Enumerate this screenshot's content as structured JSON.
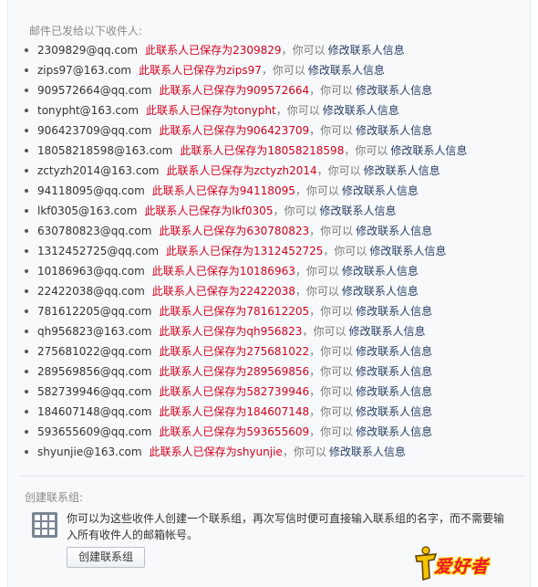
{
  "sent_heading": "邮件已发给以下收件人:",
  "recipients": [
    {
      "email": "2309829@qq.com",
      "saved": "此联系人已保存为2309829",
      "tail": "，你可以",
      "edit": "修改联系人信息"
    },
    {
      "email": "zips97@163.com",
      "saved": "此联系人已保存为zips97",
      "tail": "，你可以",
      "edit": "修改联系人信息"
    },
    {
      "email": "909572664@qq.com",
      "saved": "此联系人已保存为909572664",
      "tail": "，你可以",
      "edit": "修改联系人信息"
    },
    {
      "email": "tonypht@163.com",
      "saved": "此联系人已保存为tonypht",
      "tail": "，你可以",
      "edit": "修改联系人信息"
    },
    {
      "email": "906423709@qq.com",
      "saved": "此联系人已保存为906423709",
      "tail": "，你可以",
      "edit": "修改联系人信息"
    },
    {
      "email": "18058218598@163.com",
      "saved": "此联系人已保存为18058218598",
      "tail": "，你可以",
      "edit": "修改联系人信息"
    },
    {
      "email": "zctyzh2014@163.com",
      "saved": "此联系人已保存为zctyzh2014",
      "tail": "，你可以",
      "edit": "修改联系人信息"
    },
    {
      "email": "94118095@qq.com",
      "saved": "此联系人已保存为94118095",
      "tail": "，你可以",
      "edit": "修改联系人信息"
    },
    {
      "email": "lkf0305@163.com",
      "saved": "此联系人已保存为lkf0305",
      "tail": "，你可以",
      "edit": "修改联系人信息"
    },
    {
      "email": "630780823@qq.com",
      "saved": "此联系人已保存为630780823",
      "tail": "，你可以",
      "edit": "修改联系人信息"
    },
    {
      "email": "1312452725@qq.com",
      "saved": "此联系人已保存为1312452725",
      "tail": "，你可以",
      "edit": "修改联系人信息"
    },
    {
      "email": "10186963@qq.com",
      "saved": "此联系人已保存为10186963",
      "tail": "，你可以",
      "edit": "修改联系人信息"
    },
    {
      "email": "22422038@qq.com",
      "saved": "此联系人已保存为22422038",
      "tail": "，你可以",
      "edit": "修改联系人信息"
    },
    {
      "email": "781612205@qq.com",
      "saved": "此联系人已保存为781612205",
      "tail": "，你可以",
      "edit": "修改联系人信息"
    },
    {
      "email": "qh956823@163.com",
      "saved": "此联系人已保存为qh956823",
      "tail": "，你可以",
      "edit": "修改联系人信息"
    },
    {
      "email": "275681022@qq.com",
      "saved": "此联系人已保存为275681022",
      "tail": "，你可以",
      "edit": "修改联系人信息"
    },
    {
      "email": "289569856@qq.com",
      "saved": "此联系人已保存为289569856",
      "tail": "，你可以",
      "edit": "修改联系人信息"
    },
    {
      "email": "582739946@qq.com",
      "saved": "此联系人已保存为582739946",
      "tail": "，你可以",
      "edit": "修改联系人信息"
    },
    {
      "email": "184607148@qq.com",
      "saved": "此联系人已保存为184607148",
      "tail": "，你可以",
      "edit": "修改联系人信息"
    },
    {
      "email": "593655609@qq.com",
      "saved": "此联系人已保存为593655609",
      "tail": "，你可以",
      "edit": "修改联系人信息"
    },
    {
      "email": "shyunjie@163.com",
      "saved": "此联系人已保存为shyunjie",
      "tail": "，你可以",
      "edit": "修改联系人信息"
    }
  ],
  "group": {
    "heading": "创建联系组:",
    "icon": "grid-icon",
    "description": "你可以为这些收件人创建一个联系组，再次写信时便可直接输入联系组的名字，而不需要输入所有收件人的邮箱帐号。",
    "button_label": "创建联系组"
  },
  "watermark": {
    "text": "爱好者"
  },
  "colors": {
    "saved_text": "#d6001c",
    "link": "#2a3f66",
    "muted": "#8a8a8a",
    "panel_bg": "#f7f9fb"
  }
}
